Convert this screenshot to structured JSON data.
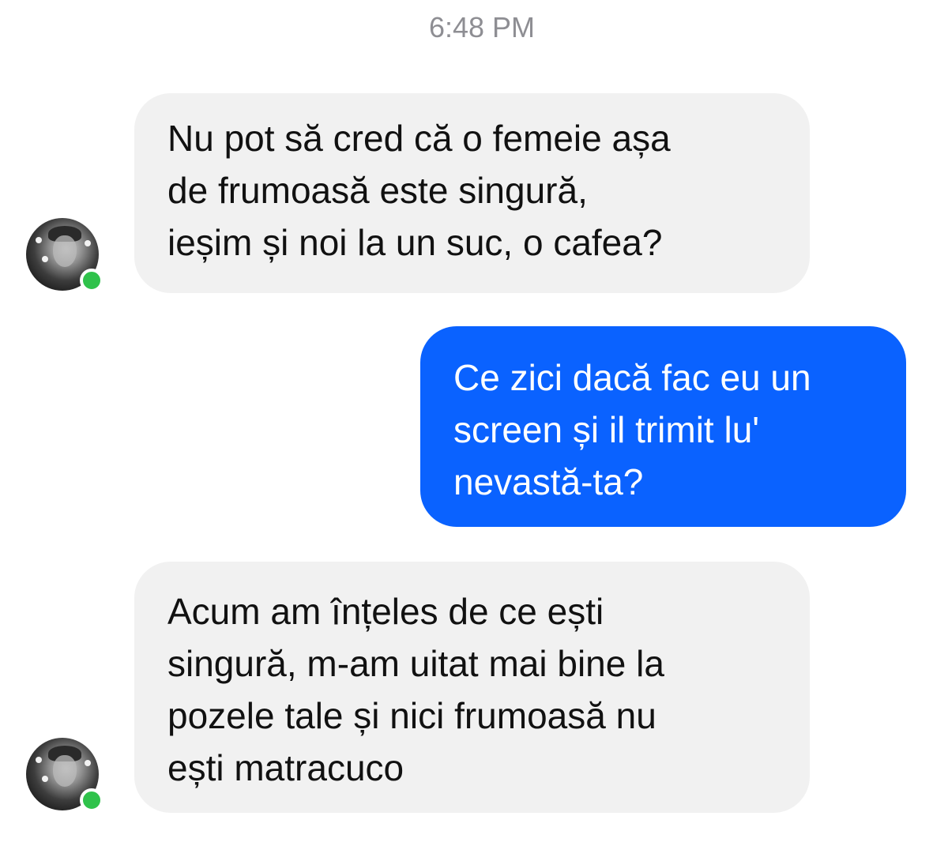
{
  "conversation": {
    "timestamp": "6:48 PM",
    "messages": [
      {
        "direction": "incoming",
        "lines": [
          "Nu pot să cred că o femeie așa",
          "de frumoasă este singură,",
          "ieșim și noi la un suc, o cafea?"
        ]
      },
      {
        "direction": "outgoing",
        "lines": [
          "Ce zici dacă fac eu un",
          "screen și il trimit lu'",
          "nevastă-ta?"
        ]
      },
      {
        "direction": "incoming",
        "lines": [
          "Acum am înțeles de ce ești",
          "singură, m-am uitat mai bine la",
          "pozele tale și nici frumoasă nu",
          "ești matracuco"
        ]
      }
    ]
  },
  "colors": {
    "incoming_bubble": "#f1f1f1",
    "outgoing_bubble": "#0a62ff",
    "online_status": "#2fc24b",
    "timestamp_text": "#8e8e93"
  },
  "icons": {
    "avatar": "contact-avatar-icon",
    "presence": "online-status-icon"
  }
}
